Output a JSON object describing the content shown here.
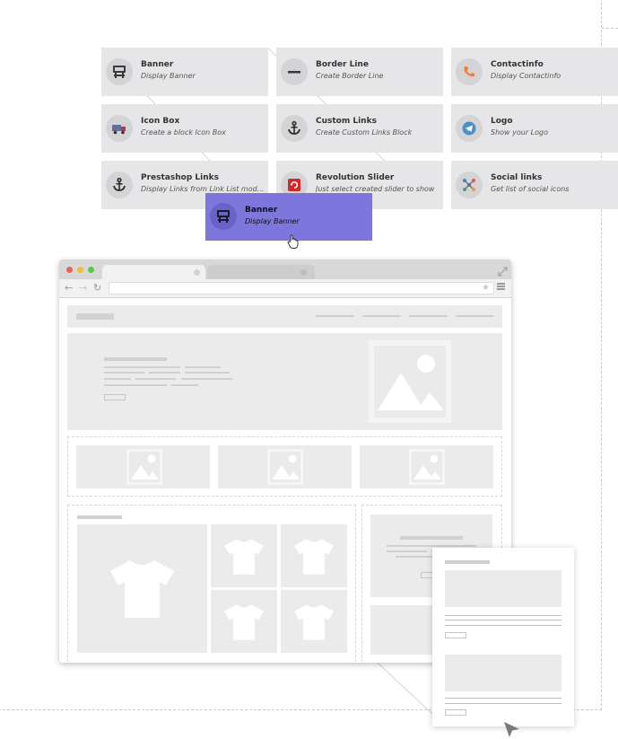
{
  "modules": [
    {
      "title": "Banner",
      "description": "Display Banner",
      "icon": "banner-icon"
    },
    {
      "title": "Border Line",
      "description": "Create Border Line",
      "icon": "minus-icon"
    },
    {
      "title": "Contactinfo",
      "description": "Display Contactinfo",
      "icon": "phone-icon"
    },
    {
      "title": "Icon Box",
      "description": "Create a block Icon Box",
      "icon": "truck-icon"
    },
    {
      "title": "Custom Links",
      "description": "Create Custom Links Block",
      "icon": "anchor-icon"
    },
    {
      "title": "Logo",
      "description": "Show your Logo",
      "icon": "telegram-icon"
    },
    {
      "title": "Prestashop Links",
      "description": "Display Links from Link List mod...",
      "icon": "anchor-icon"
    },
    {
      "title": "Revolution Slider",
      "description": "Just select created slider to show",
      "icon": "refresh-icon"
    },
    {
      "title": "Social links",
      "description": "Get list of social icons",
      "icon": "network-icon"
    }
  ],
  "dragged_module": {
    "title": "Banner",
    "description": "Display Banner",
    "icon": "banner-icon"
  },
  "colors": {
    "drag_card": "#7d76dc",
    "card_bg": "#e6e6e8",
    "window_close": "#ec5f59",
    "window_minimize": "#f3be37",
    "window_maximize": "#5cc840",
    "contact_icon": "#f07d3a",
    "logo_icon": "#4a90c8",
    "slider_icon": "#d72626",
    "truck_icon": "#5d6ea8"
  }
}
